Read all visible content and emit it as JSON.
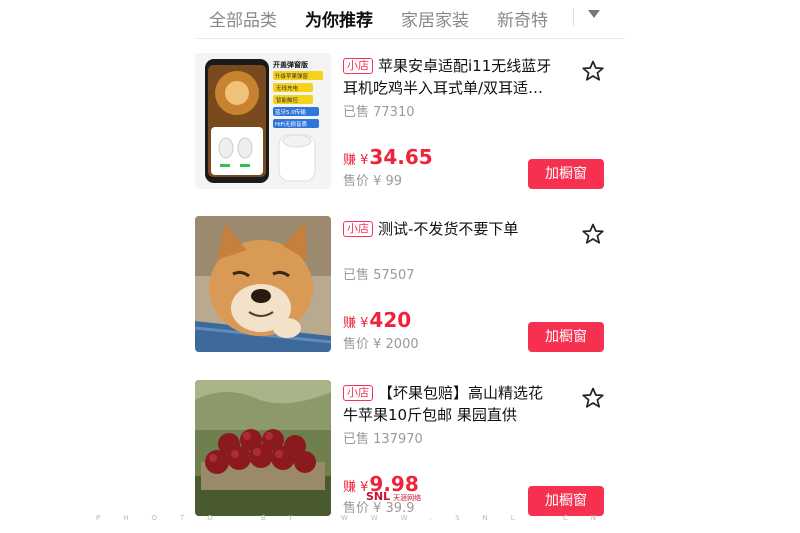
{
  "tabs": [
    {
      "label": "全部品类",
      "active": false
    },
    {
      "label": "为你推荐",
      "active": true
    },
    {
      "label": "家居家装",
      "active": false
    },
    {
      "label": "新奇特",
      "active": false
    }
  ],
  "tab_more_icon": "caret-down-icon",
  "products": [
    {
      "shop_tag": "小店",
      "title_line1": "苹果安卓适配i11无线蓝牙",
      "title_line2": "耳机吃鸡半入耳式单/双耳适…",
      "sold": "已售 77310",
      "earn_label": "赚 ¥",
      "earn_amount": "34.65",
      "price": "售价 ¥ 99",
      "button": "加橱窗",
      "image_text": {
        "headline": "开盖弹窗版",
        "badges": [
          "升级苹果弹窗",
          "无线充电",
          "智能触控",
          "蓝牙5.0传输",
          "HiFi无损音质"
        ]
      }
    },
    {
      "shop_tag": "小店",
      "title_line1": "测试-不发货不要下单",
      "title_line2": "",
      "sold": "已售 57507",
      "earn_label": "赚 ¥",
      "earn_amount": "420",
      "price": "售价 ¥ 2000",
      "button": "加橱窗"
    },
    {
      "shop_tag": "小店",
      "title_line1": "【坏果包赔】高山精选花",
      "title_line2": "牛苹果10斤包邮 果园直供",
      "sold": "已售 137970",
      "earn_label": "赚 ¥",
      "earn_amount": "9.98",
      "price": "售价 ¥ 39.9",
      "button": "加橱窗"
    }
  ],
  "watermark": "PHOTO BY WWW.SNL.CN",
  "logo": {
    "brand": "SNL",
    "sub": "天涯网络"
  },
  "colors": {
    "accent": "#f6304f",
    "earn": "#f0233a",
    "muted": "#9a9a9a"
  }
}
